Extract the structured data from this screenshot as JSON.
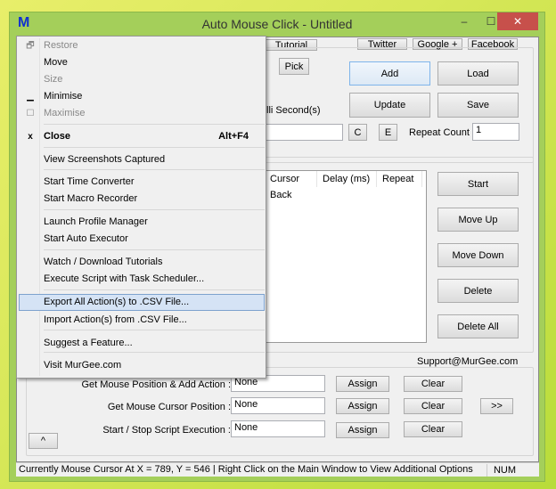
{
  "window": {
    "title": "Auto Mouse Click - Untitled",
    "logo": "M",
    "min": "–",
    "max": "☐",
    "close": "✕"
  },
  "top_links": {
    "tutorial": "Tutorial",
    "twitter": "Twitter",
    "google": "Google +",
    "facebook": "Facebook"
  },
  "action": {
    "pick": "Pick",
    "add": "Add",
    "load": "Load",
    "update": "Update",
    "save": "Save",
    "delay_unit": "lli Second(s)",
    "c": "C",
    "e": "E",
    "repeat_count_label": "Repeat Count :",
    "repeat_count": "1"
  },
  "table": {
    "columns": [
      "Cursor Back",
      "Delay (ms)",
      "Repeat"
    ]
  },
  "list_buttons": {
    "start": "Start",
    "move_up": "Move Up",
    "move_down": "Move Down",
    "delete": "Delete",
    "delete_all": "Delete All"
  },
  "hotkeys": {
    "support": "Support@MurGee.com",
    "rows": [
      {
        "label": "Get Mouse Position & Add Action :",
        "value": "None",
        "assign": "Assign",
        "clear": "Clear"
      },
      {
        "label": "Get Mouse Cursor Position :",
        "value": "None",
        "assign": "Assign",
        "clear": "Clear"
      },
      {
        "label": "Start / Stop Script Execution :",
        "value": "None",
        "assign": "Assign",
        "clear": "Clear"
      }
    ],
    "more": ">>",
    "collapse": "^"
  },
  "status": {
    "text": "Currently Mouse Cursor At X = 789, Y = 546 | Right Click on the Main Window to View Additional Options",
    "num": "NUM"
  },
  "menu": {
    "items": [
      {
        "label": "Restore",
        "icon": "restore-icon",
        "glyph": "🗗",
        "disabled": true
      },
      {
        "label": "Move"
      },
      {
        "label": "Size",
        "disabled": true
      },
      {
        "label": "Minimise",
        "icon": "minimise-icon",
        "glyph": "▁"
      },
      {
        "label": "Maximise",
        "icon": "maximise-icon",
        "glyph": "☐",
        "disabled": true
      },
      {
        "label": "Close",
        "icon": "close-icon",
        "glyph": "x",
        "shortcut": "Alt+F4",
        "bold": true
      },
      {
        "label": "View Screenshots Captured"
      },
      {
        "label": "Start Time Converter"
      },
      {
        "label": "Start Macro Recorder"
      },
      {
        "label": "Launch Profile Manager"
      },
      {
        "label": "Start Auto Executor"
      },
      {
        "label": "Watch / Download Tutorials"
      },
      {
        "label": "Execute Script with Task Scheduler..."
      },
      {
        "label": "Export All Action(s) to .CSV File...",
        "highlighted": true
      },
      {
        "label": "Import Action(s) from .CSV File..."
      },
      {
        "label": "Suggest a Feature..."
      },
      {
        "label": "Visit MurGee.com"
      }
    ]
  }
}
